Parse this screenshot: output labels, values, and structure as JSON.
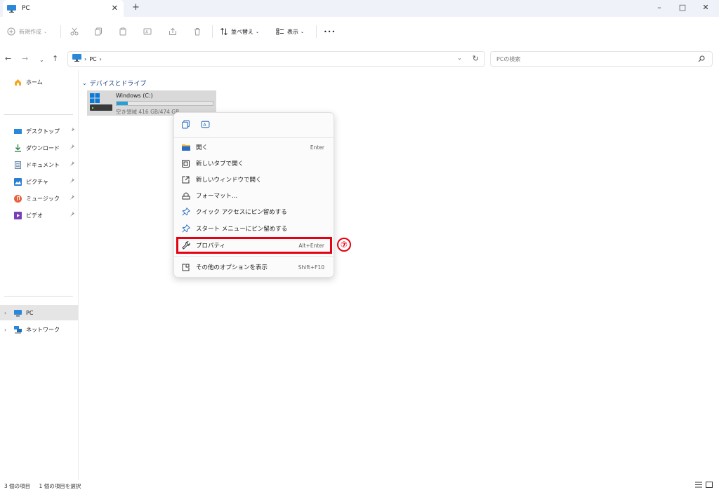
{
  "window": {
    "tab_title": "PC",
    "minimize": "–",
    "maximize": "□",
    "close": "✕",
    "new_tab": "+",
    "tab_close": "✕"
  },
  "toolbar": {
    "new_label": "新規作成",
    "sort_label": "並べ替え",
    "view_label": "表示",
    "more_label": "•••"
  },
  "address": {
    "crumb_root": "PC",
    "sep": "›",
    "search_placeholder": "PCの検索"
  },
  "sidebar": {
    "home": "ホーム",
    "quick": [
      {
        "label": "デスクトップ",
        "icon": "desktop-icon"
      },
      {
        "label": "ダウンロード",
        "icon": "download-icon"
      },
      {
        "label": "ドキュメント",
        "icon": "document-icon"
      },
      {
        "label": "ピクチャ",
        "icon": "picture-icon"
      },
      {
        "label": "ミュージック",
        "icon": "music-icon"
      },
      {
        "label": "ビデオ",
        "icon": "video-icon"
      }
    ],
    "pc": "PC",
    "network": "ネットワーク"
  },
  "main": {
    "group_header": "デバイスとドライブ",
    "drive": {
      "name": "Windows (C:)",
      "free_text": "空き領域 416 GB/474 GB",
      "used_fraction": 0.12
    }
  },
  "context_menu": {
    "items": [
      {
        "label": "開く",
        "shortcut": "Enter",
        "icon": "folder-open-icon"
      },
      {
        "label": "新しいタブで開く",
        "shortcut": "",
        "icon": "new-tab-icon"
      },
      {
        "label": "新しいウィンドウで開く",
        "shortcut": "",
        "icon": "new-window-icon"
      },
      {
        "label": "フォーマット...",
        "shortcut": "",
        "icon": "format-icon"
      },
      {
        "label": "クイック アクセスにピン留めする",
        "shortcut": "",
        "icon": "pin-icon"
      },
      {
        "label": "スタート メニューにピン留めする",
        "shortcut": "",
        "icon": "pin-icon"
      },
      {
        "label": "プロパティ",
        "shortcut": "Alt+Enter",
        "icon": "wrench-icon"
      },
      {
        "label": "その他のオプションを表示",
        "shortcut": "Shift+F10",
        "icon": "more-options-icon"
      }
    ],
    "annotation": "⑦"
  },
  "status": {
    "item_count": "3 個の項目",
    "selected": "1 個の項目を選択"
  },
  "colors": {
    "accent": "#26a0da",
    "highlight": "#e60012",
    "folder_blue": "#1a3c84"
  }
}
